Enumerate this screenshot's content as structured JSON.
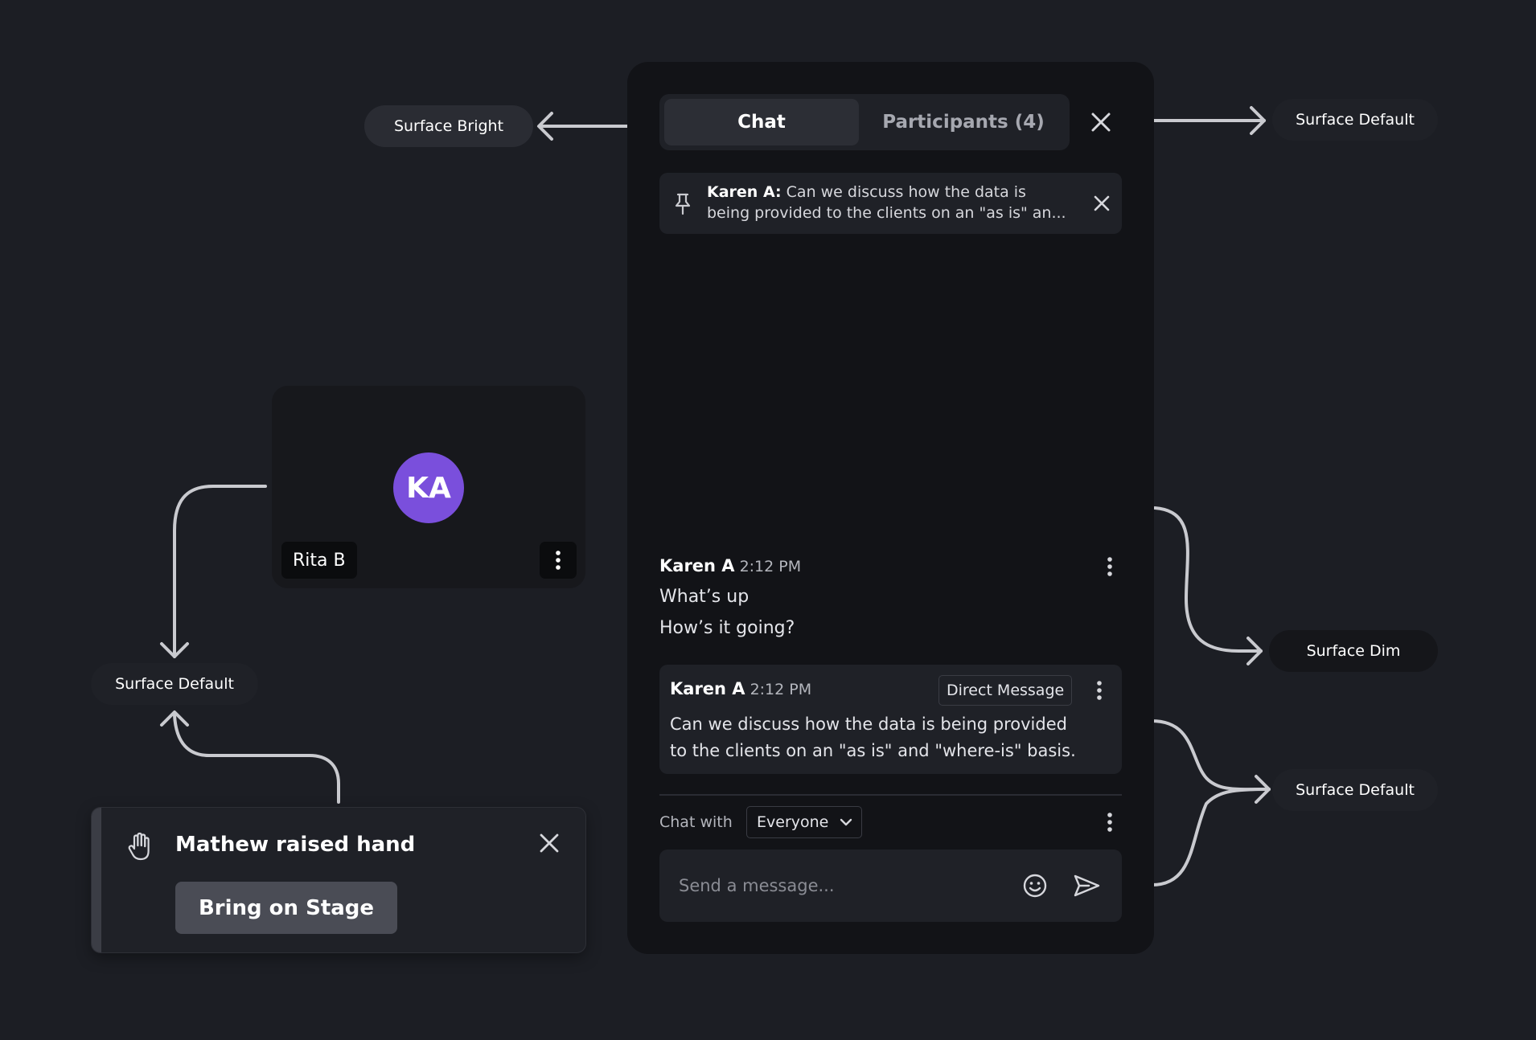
{
  "annotations": {
    "surface_bright": "Surface Bright",
    "surface_default_top": "Surface Default",
    "surface_dim": "Surface Dim",
    "surface_default_right": "Surface Default",
    "surface_default_left": "Surface Default"
  },
  "chat_panel": {
    "tabs": {
      "chat": "Chat",
      "participants": "Participants (4)"
    },
    "pinned": {
      "author": "Karen A:",
      "line1": "Can we discuss how the data is",
      "line2": "being provided to the clients on an \"as is\" an..."
    },
    "message1": {
      "author": "Karen A",
      "time": "2:12 PM",
      "lines": [
        "What’s up",
        "How’s it going?"
      ]
    },
    "message2": {
      "author": "Karen A",
      "time": "2:12 PM",
      "badge": "Direct Message",
      "lines": [
        "Can we discuss how the data is being provided",
        "to the clients on an \"as is\" and \"where-is\" basis."
      ]
    },
    "chat_with": {
      "label": "Chat with",
      "selected": "Everyone"
    },
    "composer": {
      "placeholder": "Send a message..."
    }
  },
  "participant_tile": {
    "initials": "KA",
    "name": "Rita B",
    "avatar_color": "#7a4fdc"
  },
  "hand_toast": {
    "title": "Mathew raised hand",
    "button": "Bring on Stage"
  },
  "icons": {
    "close": "close-icon",
    "pin": "pin-icon",
    "kebab": "kebab-menu-icon",
    "chevron": "chevron-down-icon",
    "emoji": "emoji-icon",
    "send": "send-icon",
    "hand": "raised-hand-icon"
  }
}
